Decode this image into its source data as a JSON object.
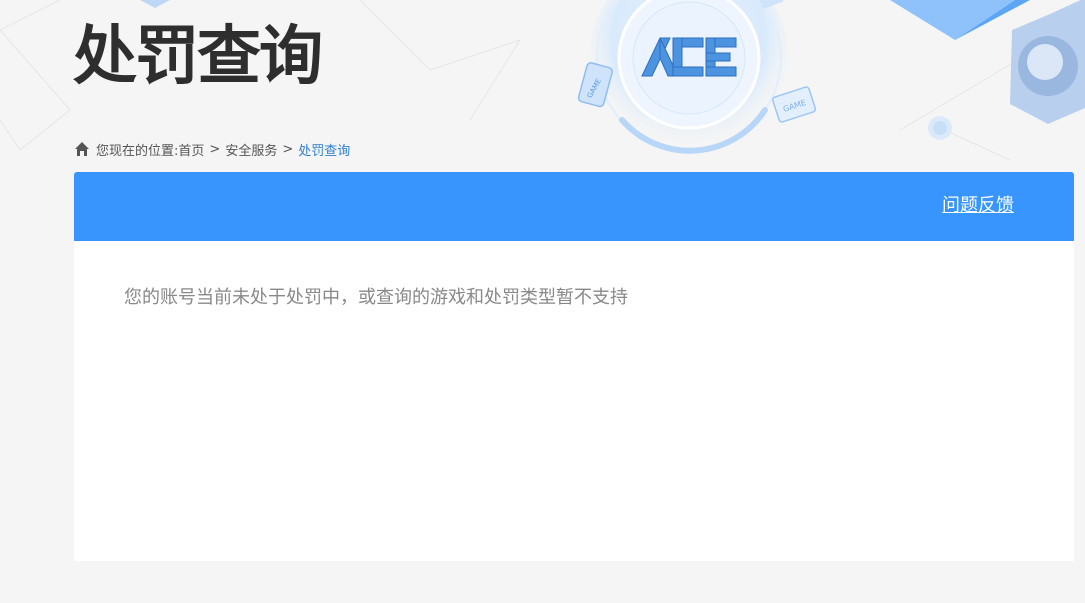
{
  "page": {
    "title": "处罚查询"
  },
  "breadcrumb": {
    "prefix": "您现在的位置:",
    "items": [
      "首页",
      "安全服务",
      "处罚查询"
    ],
    "separator": ">"
  },
  "panel": {
    "feedback_label": "问题反馈",
    "message": "您的账号当前未处于处罚中，或查询的游戏和处罚类型暂不支持"
  },
  "logo": {
    "text": "ACE",
    "badge_text": "GAME"
  },
  "colors": {
    "accent": "#3795fd",
    "breadcrumb_current": "#2c7fd1",
    "title": "#2e2e2e",
    "message": "#888888",
    "background": "#f5f5f5"
  },
  "icons": {
    "breadcrumb": "home-icon",
    "hero": "ace-logo-icon"
  }
}
